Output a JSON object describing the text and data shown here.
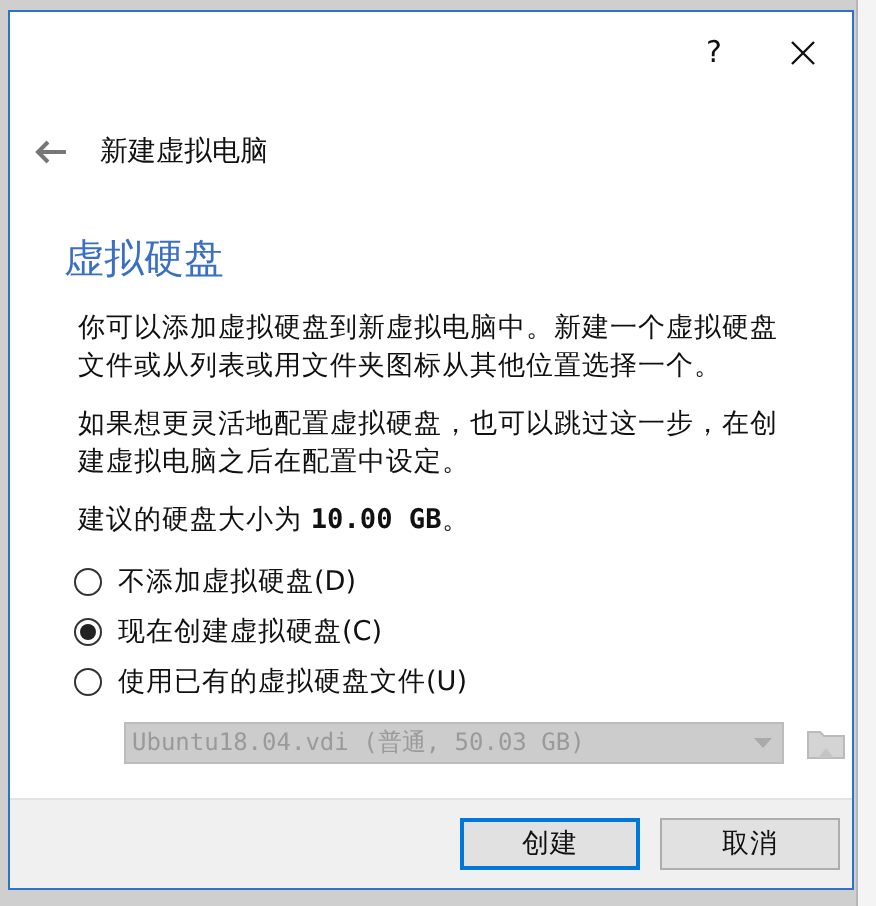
{
  "window": {
    "help": "?"
  },
  "header": {
    "title": "新建虚拟电脑"
  },
  "heading": "虚拟硬盘",
  "paragraphs": [
    "你可以添加虚拟硬盘到新虚拟电脑中。新建一个虚拟硬盘文件或从列表或用文件夹图标从其他位置选择一个。",
    "如果想更灵活地配置虚拟硬盘，也可以跳过这一步，在创建虚拟电脑之后在配置中设定。",
    "建议的硬盘大小为 **10.00 GB**。"
  ],
  "options": [
    {
      "label": "不添加虚拟硬盘(D)",
      "selected": false
    },
    {
      "label": "现在创建虚拟硬盘(C)",
      "selected": true
    },
    {
      "label": "使用已有的虚拟硬盘文件(U)",
      "selected": false
    }
  ],
  "disk_select": {
    "value": "Ubuntu18.04.vdi (普通, 50.03 GB)",
    "disabled": true
  },
  "buttons": [
    {
      "label": "创建",
      "default": true
    },
    {
      "label": "取消",
      "default": false
    }
  ]
}
